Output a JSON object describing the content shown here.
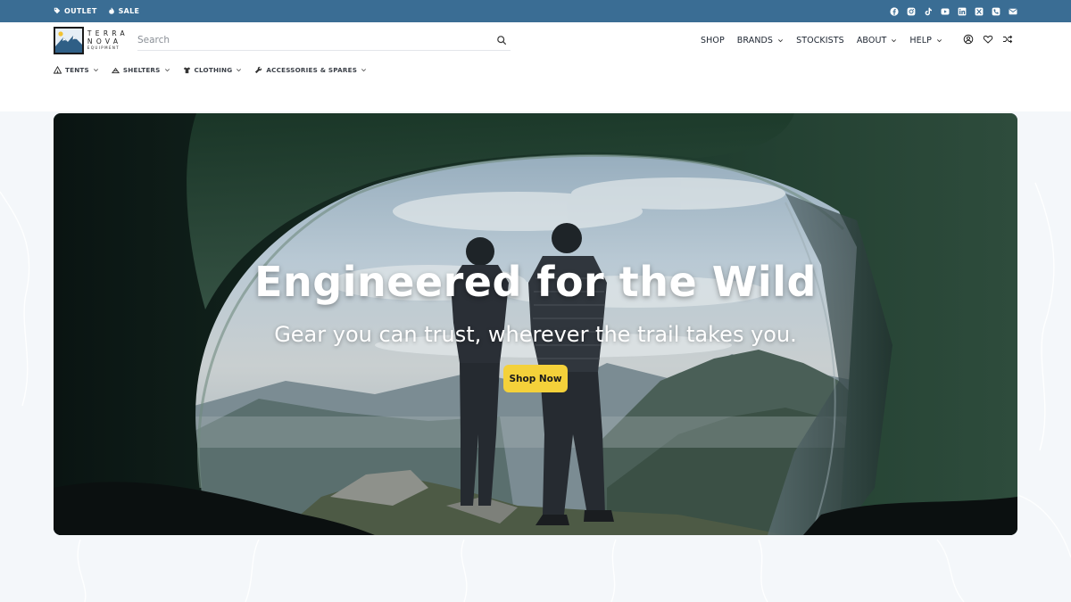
{
  "topbar": {
    "outlet_label": "OUTLET",
    "sale_label": "SALE",
    "background": "#3a6d94",
    "social_icons": [
      "facebook-icon",
      "instagram-icon",
      "tiktok-icon",
      "youtube-icon",
      "linkedin-icon",
      "x-icon",
      "phone-icon",
      "mail-icon"
    ]
  },
  "logo": {
    "line1": "TERRA",
    "line2": "NOVA",
    "line3": "EQUIPMENT"
  },
  "search": {
    "placeholder": "Search",
    "value": ""
  },
  "mainnav": {
    "items": [
      {
        "label": "SHOP",
        "dropdown": false
      },
      {
        "label": "BRANDS",
        "dropdown": true
      },
      {
        "label": "STOCKISTS",
        "dropdown": false
      },
      {
        "label": "ABOUT",
        "dropdown": true
      },
      {
        "label": "HELP",
        "dropdown": true
      }
    ],
    "utility_icons": [
      "account-icon",
      "wishlist-heart-icon",
      "compare-shuffle-icon"
    ]
  },
  "catnav": {
    "items": [
      {
        "label": "TENTS",
        "icon": "tent-icon"
      },
      {
        "label": "SHELTERS",
        "icon": "shelter-icon"
      },
      {
        "label": "CLOTHING",
        "icon": "shirt-icon"
      },
      {
        "label": "ACCESSORIES & SPARES",
        "icon": "wrench-icon"
      }
    ]
  },
  "hero": {
    "title": "Engineered for the Wild",
    "subtitle": "Gear you can trust, wherever the trail takes you.",
    "cta_label": "Shop Now",
    "cta_color": "#f4d13a"
  }
}
